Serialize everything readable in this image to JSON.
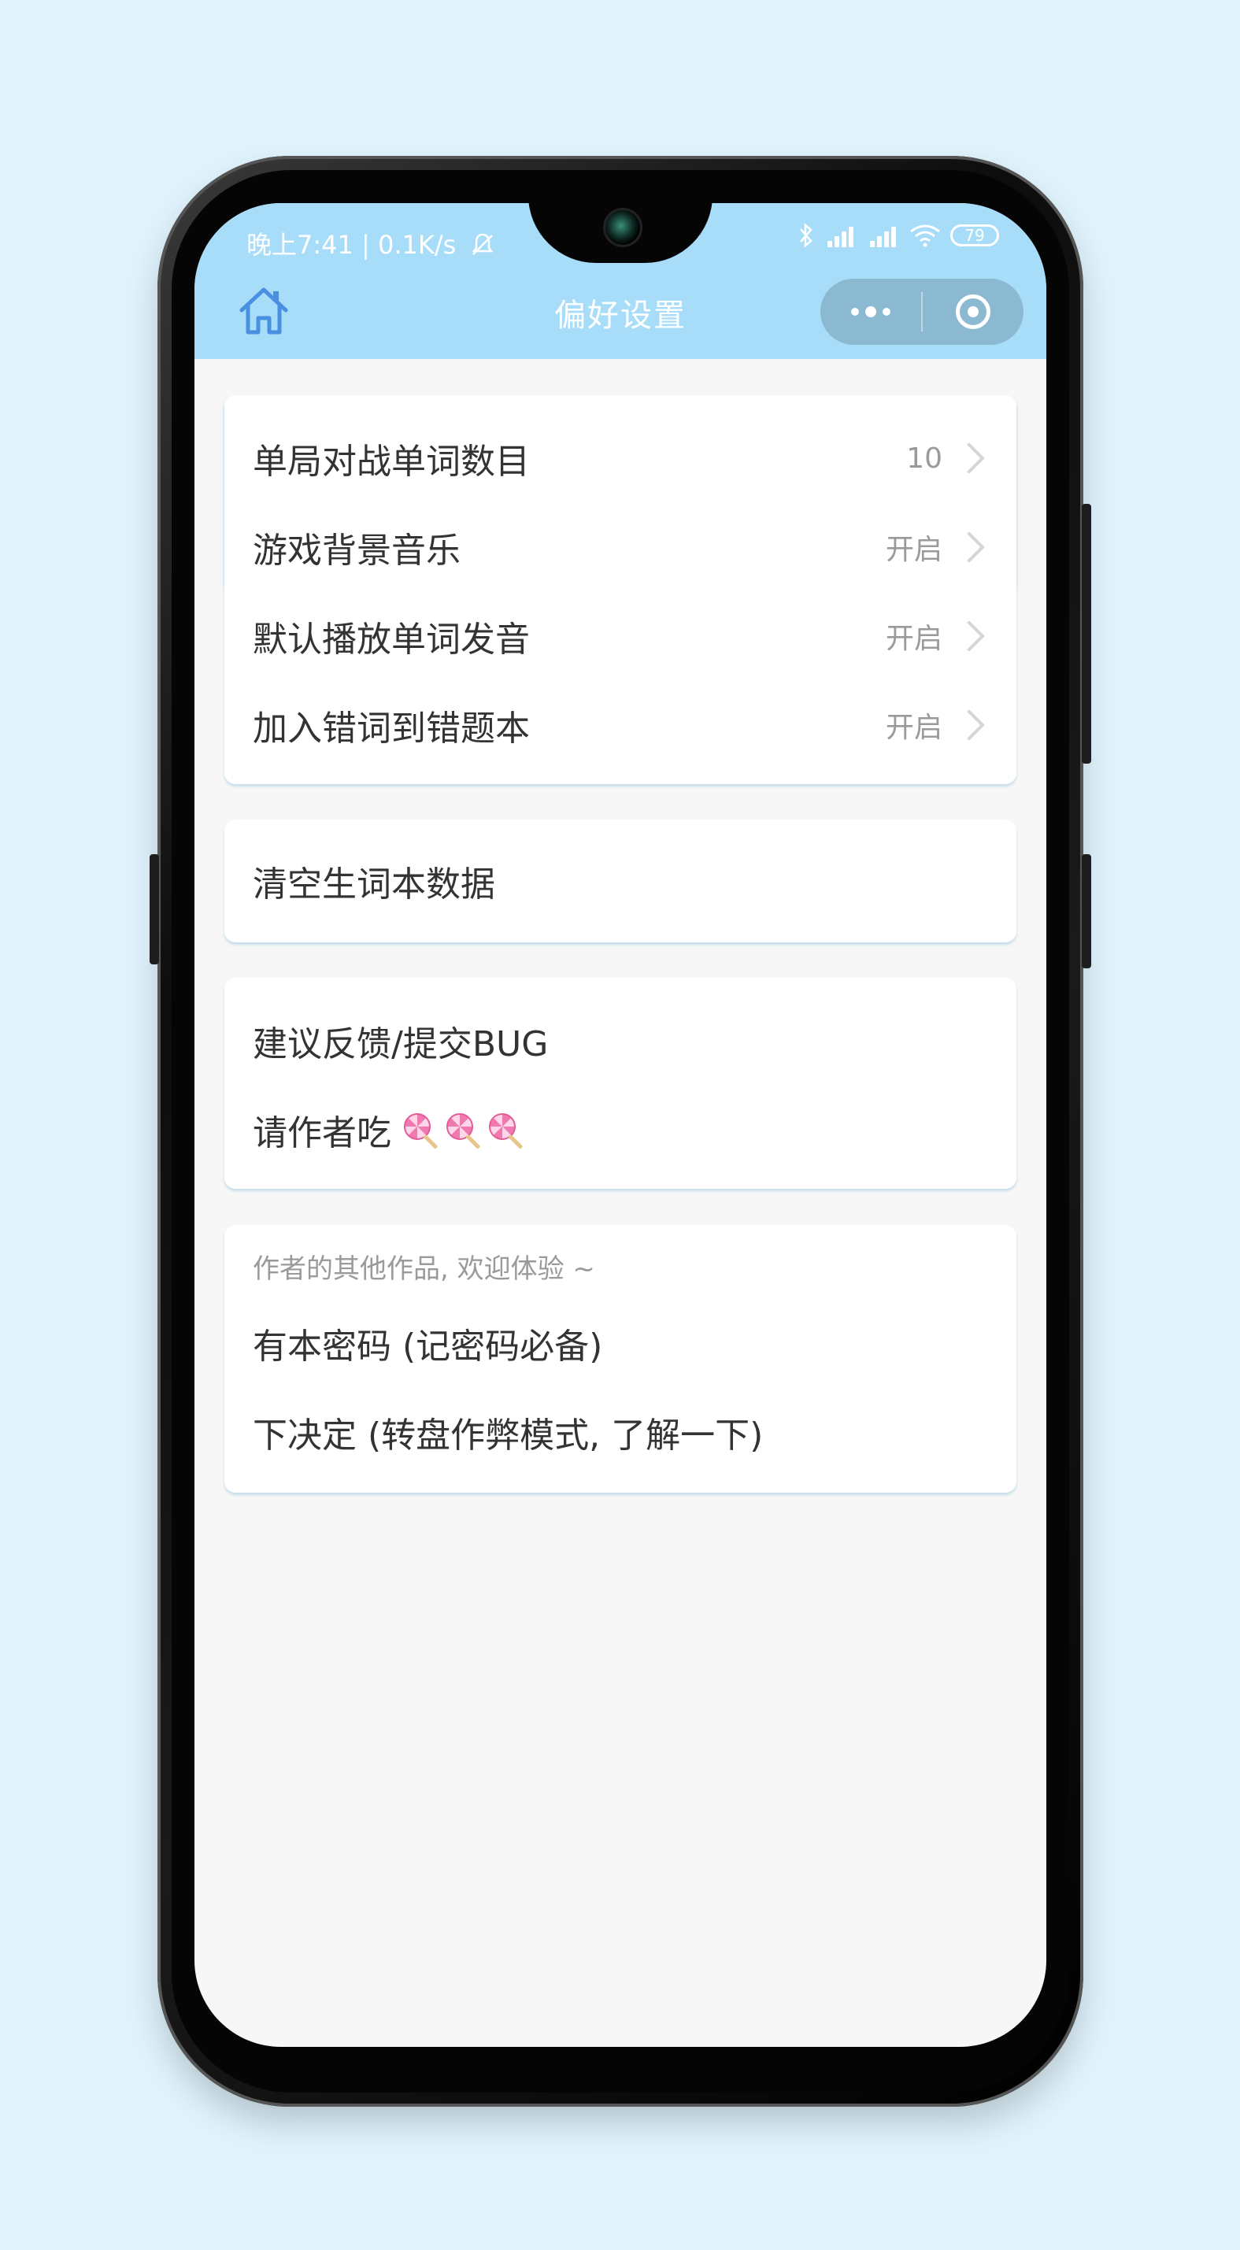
{
  "status_bar": {
    "left": "晚上7:41 | 0.1K/s",
    "battery": "79"
  },
  "nav": {
    "title": "偏好设置"
  },
  "settings": [
    {
      "label": "单局对战单词数目",
      "value": "10"
    },
    {
      "label": "游戏背景音乐",
      "value": "开启"
    },
    {
      "label": "默认播放单词发音",
      "value": "开启"
    },
    {
      "label": "加入错词到错题本",
      "value": "开启"
    }
  ],
  "clear": {
    "label": "清空生词本数据"
  },
  "feedback": {
    "suggest": "建议反馈/提交BUG",
    "treat": "请作者吃"
  },
  "other_works": {
    "header": "作者的其他作品, 欢迎体验 ~",
    "items": [
      "有本密码 (记密码必备)",
      "下决定 (转盘作弊模式, 了解一下)"
    ]
  },
  "colors": {
    "background": "#e0f3fd",
    "header": "#a7ddf9",
    "capsule": "#8cb9d2",
    "text": "#333333",
    "muted": "#9a9a9a"
  }
}
